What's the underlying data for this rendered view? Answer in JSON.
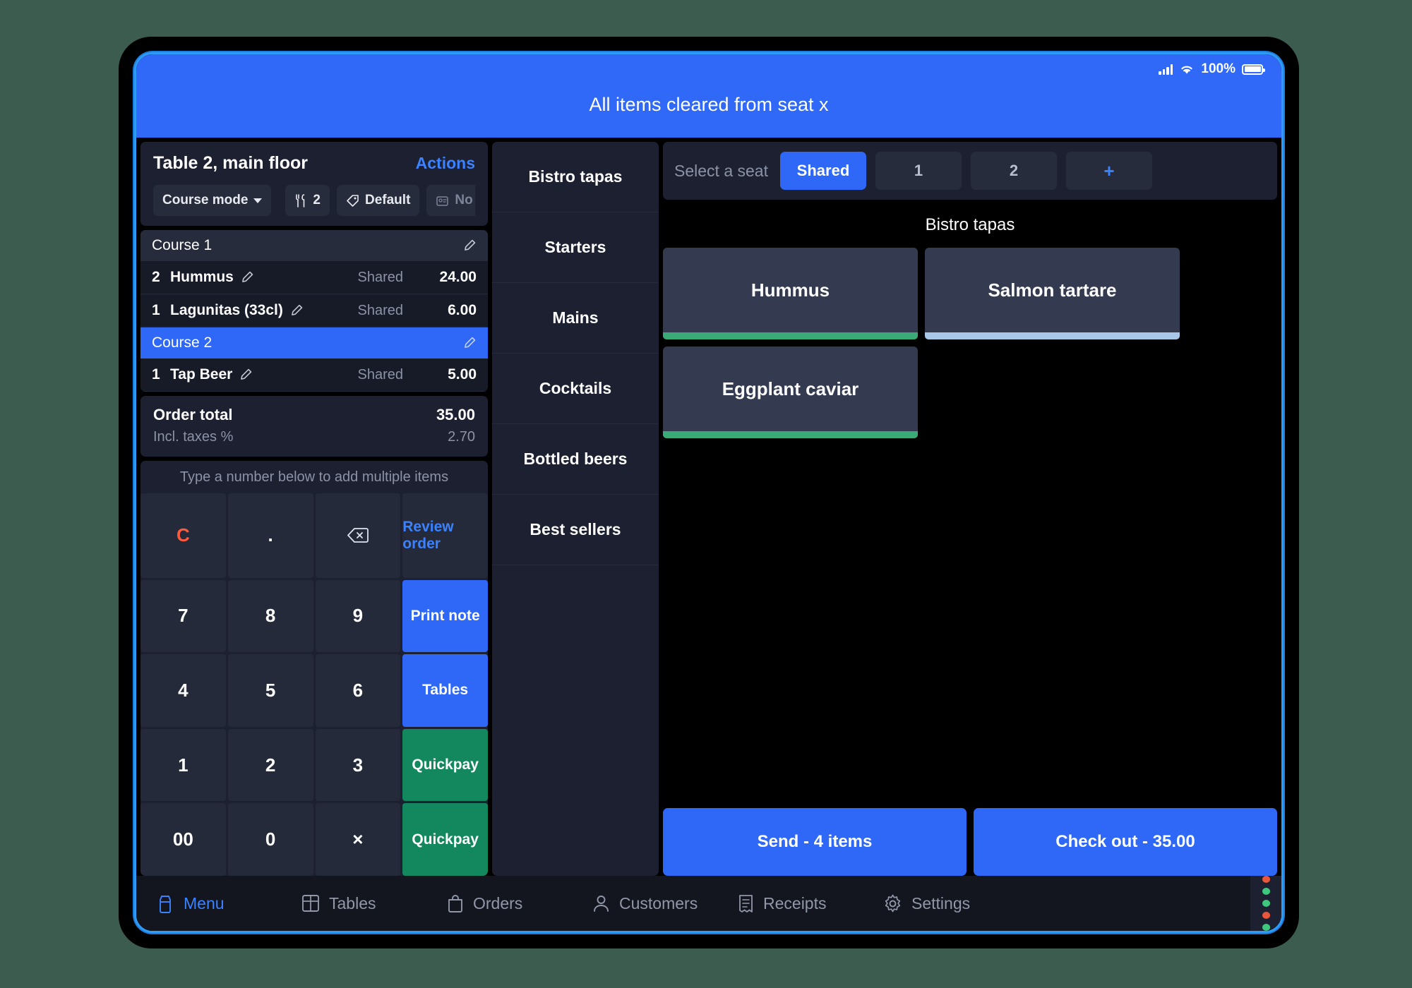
{
  "statusbar": {
    "battery_pct": "100%",
    "signal_icon": "cellular-bars-icon",
    "wifi_icon": "wifi-icon",
    "battery_icon": "battery-icon"
  },
  "banner": {
    "message": "All items cleared from seat x",
    "bg": "#3069f7"
  },
  "order": {
    "title": "Table 2, main floor",
    "actions_label": "Actions",
    "chips": [
      {
        "label": "Course mode",
        "icon": "chevron-down-icon"
      },
      {
        "label": "2",
        "icon": "cutlery-icon"
      },
      {
        "label": "Default",
        "icon": "tag-icon"
      },
      {
        "label": "No c",
        "icon": "customer-icon"
      }
    ],
    "lines": [
      {
        "kind": "course",
        "label": "Course 1",
        "active": false
      },
      {
        "kind": "item",
        "qty": "2",
        "name": "Hummus",
        "seat": "Shared",
        "price": "24.00"
      },
      {
        "kind": "item",
        "qty": "1",
        "name": "Lagunitas (33cl)",
        "seat": "Shared",
        "price": "6.00"
      },
      {
        "kind": "course",
        "label": "Course 2",
        "active": true
      },
      {
        "kind": "item",
        "qty": "1",
        "name": "Tap Beer",
        "seat": "Shared",
        "price": "5.00"
      }
    ],
    "total_label": "Order total",
    "total_value": "35.00",
    "tax_label": "Incl. taxes %",
    "tax_value": "2.70"
  },
  "keypad": {
    "hint": "Type a number below to add multiple items",
    "keys": [
      {
        "label": "C",
        "style": "clear",
        "name": "clear-key"
      },
      {
        "label": ".",
        "style": "plain",
        "name": "decimal-key"
      },
      {
        "label": "",
        "style": "plain",
        "name": "backspace-key",
        "icon": "backspace-icon"
      },
      {
        "label": "Review order",
        "style": "link",
        "name": "review-order-button"
      },
      {
        "label": "7",
        "style": "plain",
        "name": "digit-7-key"
      },
      {
        "label": "8",
        "style": "plain",
        "name": "digit-8-key"
      },
      {
        "label": "9",
        "style": "plain",
        "name": "digit-9-key"
      },
      {
        "label": "Print note",
        "style": "blue",
        "name": "print-note-button"
      },
      {
        "label": "4",
        "style": "plain",
        "name": "digit-4-key"
      },
      {
        "label": "5",
        "style": "plain",
        "name": "digit-5-key"
      },
      {
        "label": "6",
        "style": "plain",
        "name": "digit-6-key"
      },
      {
        "label": "Tables",
        "style": "blue",
        "name": "tables-button"
      },
      {
        "label": "1",
        "style": "plain",
        "name": "digit-1-key"
      },
      {
        "label": "2",
        "style": "plain",
        "name": "digit-2-key"
      },
      {
        "label": "3",
        "style": "plain",
        "name": "digit-3-key"
      },
      {
        "label": "Quickpay",
        "style": "green",
        "name": "quickpay-button-1"
      },
      {
        "label": "00",
        "style": "plain",
        "name": "digit-00-key"
      },
      {
        "label": "0",
        "style": "plain",
        "name": "digit-0-key"
      },
      {
        "label": "×",
        "style": "plain",
        "name": "multiply-key"
      },
      {
        "label": "Quickpay",
        "style": "green",
        "name": "quickpay-button-2"
      }
    ]
  },
  "categories": [
    {
      "label": "Bistro tapas"
    },
    {
      "label": "Starters"
    },
    {
      "label": "Mains"
    },
    {
      "label": "Cocktails"
    },
    {
      "label": "Bottled beers"
    },
    {
      "label": "Best sellers"
    }
  ],
  "seats": {
    "label": "Select a seat",
    "options": [
      {
        "label": "Shared",
        "active": true
      },
      {
        "label": "1",
        "active": false
      },
      {
        "label": "2",
        "active": false
      },
      {
        "label": "+",
        "active": false,
        "is_add": true
      }
    ]
  },
  "catalog": {
    "title": "Bistro tapas",
    "products": [
      {
        "label": "Hummus",
        "accent": "#3aab77"
      },
      {
        "label": "Salmon tartare",
        "accent": "#a8c8ea"
      },
      {
        "label": "Eggplant caviar",
        "accent": "#3aab77"
      }
    ]
  },
  "actions": {
    "send_label": "Send - 4 items",
    "checkout_label": "Check out - 35.00"
  },
  "nav": [
    {
      "label": "Menu",
      "icon": "menu-icon",
      "active": true
    },
    {
      "label": "Tables",
      "icon": "tables-icon",
      "active": false
    },
    {
      "label": "Orders",
      "icon": "bag-icon",
      "active": false
    },
    {
      "label": "Customers",
      "icon": "person-icon",
      "active": false
    },
    {
      "label": "Receipts",
      "icon": "receipt-icon",
      "active": false
    },
    {
      "label": "Settings",
      "icon": "gear-icon",
      "active": false
    }
  ],
  "status_dots": [
    "#e8563c",
    "#3ec77e",
    "#3ec77e",
    "#e8563c",
    "#3ec77e"
  ],
  "colors": {
    "accent_blue": "#2f68f7",
    "green": "#13875e",
    "red": "#ff5a3c",
    "panel": "#1c2030"
  }
}
